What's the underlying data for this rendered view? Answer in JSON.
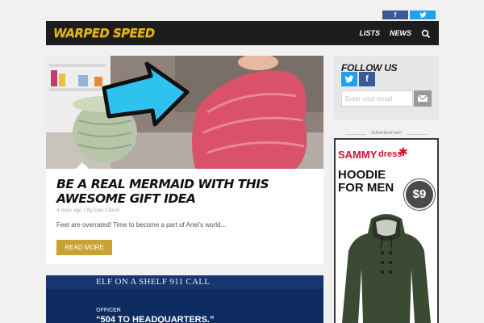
{
  "top_social": {
    "facebook_icon": "f",
    "twitter_icon": "🐦"
  },
  "header": {
    "logo": "WARPED SPEED",
    "nav": [
      "LISTS",
      "NEWS"
    ],
    "search_icon": "search-icon"
  },
  "featured": {
    "title": "BE A REAL MERMAID WITH THIS AWESOME GIFT IDEA",
    "meta": "4 days ago  |  By Dan Clavin",
    "excerpt": "Feet are overrated! Time to become a part of Ariel’s world...",
    "read_more": "READ MORE"
  },
  "second": {
    "banner": "ELF ON A SHELF 911 CALL",
    "label": "OFFICER",
    "quote": "“504 TO HEADQUARTERS.”"
  },
  "follow": {
    "title": "FOLLOW US",
    "twitter": "t",
    "facebook": "f",
    "email_placeholder": "Enter your email"
  },
  "ad": {
    "label": "Advertisement",
    "brand_a": "SAMMY",
    "brand_b": "dress",
    "headline_1": "HOODIE",
    "headline_2": "FOR MEN",
    "price": "$9"
  },
  "colors": {
    "accent": "#c9a233",
    "navbar": "#1d1d1d",
    "logo": "#e2b418",
    "twitter": "#1da1f2",
    "facebook": "#3b5998"
  }
}
